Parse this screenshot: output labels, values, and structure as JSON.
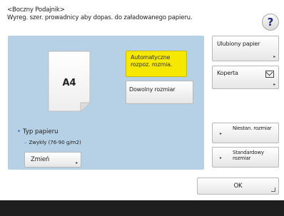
{
  "header": {
    "title": "<Boczny Podajnik>",
    "subtitle": "Wyreg. szer. prowadnicy aby dopas. do załadowanego papieru."
  },
  "help": {
    "label": "?"
  },
  "paper": {
    "size_label": "A4"
  },
  "size_options": {
    "auto": "Automatyczne rozpoz. rozmia.",
    "free": "Dowolny rozmiar"
  },
  "right_buttons": {
    "favorite": "Ulubiony papier",
    "envelope": "Koperta",
    "nonstandard": "Niestan. rozmiar",
    "standard": "Standardowy rozmiar"
  },
  "paper_type": {
    "label": "Typ papieru",
    "value": "Zwykły (76-90 g/m2)",
    "change_label": "Zmień"
  },
  "footer": {
    "ok_label": "OK"
  },
  "colors": {
    "panel": "#b6d0e6",
    "selected": "#f6e800",
    "bottom_bar": "#1f1f1f"
  }
}
